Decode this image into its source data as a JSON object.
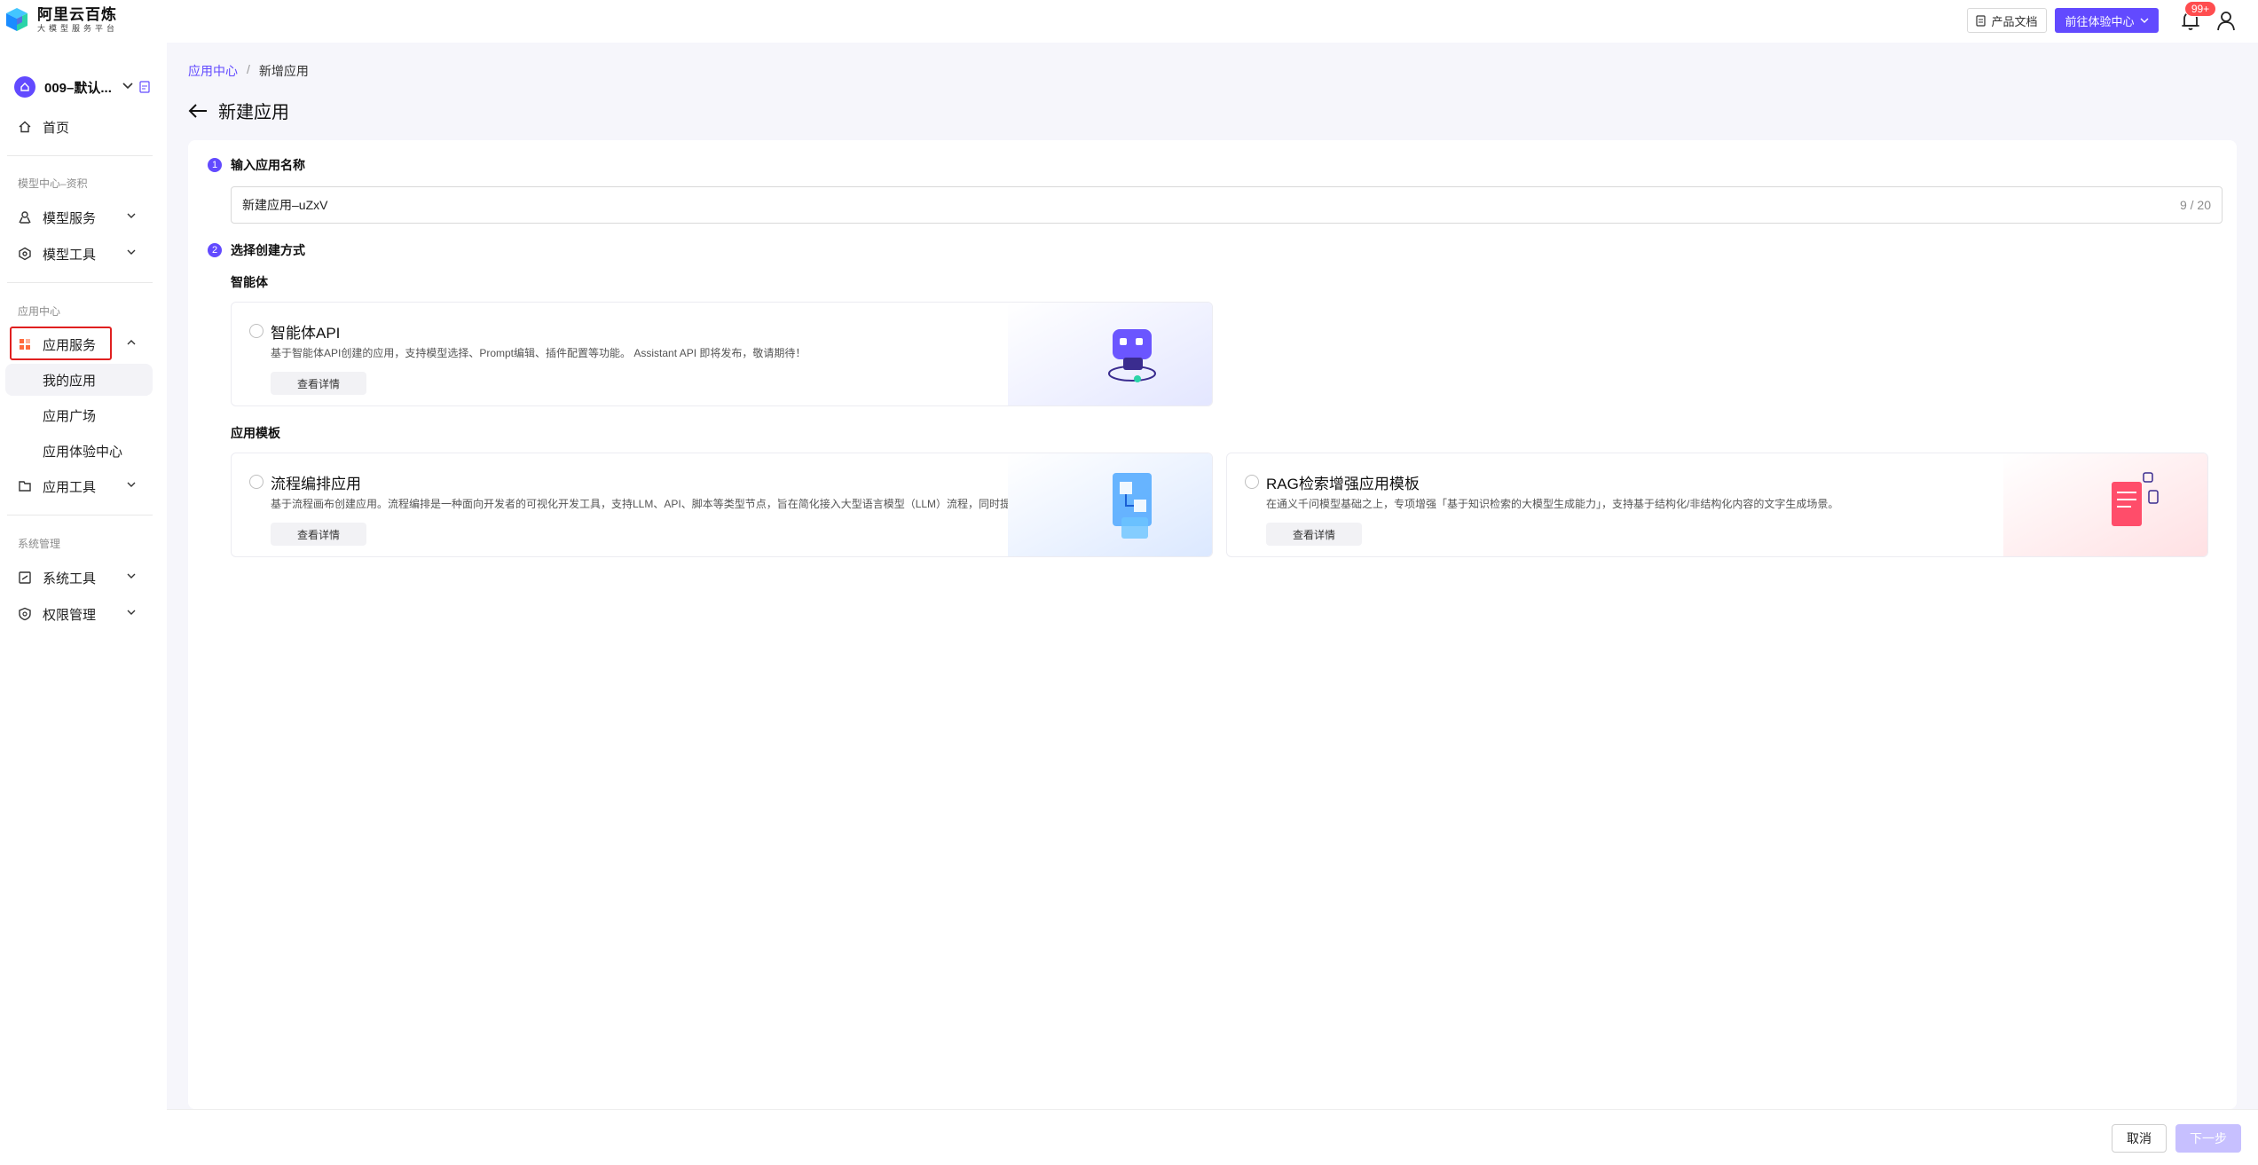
{
  "brand": {
    "name": "阿里云百炼",
    "subtitle": "大模型服务平台",
    "colors": {
      "primary": "#624aff",
      "danger": "#ff4d4f"
    }
  },
  "header": {
    "docs_label": "产品文档",
    "experience_label": "前往体验中心",
    "notification_count": "99+"
  },
  "sidebar": {
    "workspace_name": "009–默认...",
    "home": "首页",
    "section_model": "模型中心–资积",
    "model_service": "模型服务",
    "model_tools": "模型工具",
    "section_app": "应用中心",
    "app_service": "应用服务",
    "my_apps": "我的应用",
    "app_plaza": "应用广场",
    "app_experience": "应用体验中心",
    "app_tools": "应用工具",
    "section_system": "系统管理",
    "system_tools": "系统工具",
    "permissions": "权限管理"
  },
  "breadcrumb": {
    "root": "应用中心",
    "sep": "/",
    "current": "新增应用"
  },
  "page": {
    "title": "新建应用"
  },
  "form": {
    "step1_num": "1",
    "step1_label": "输入应用名称",
    "name_value": "新建应用–uZxV",
    "name_counter": "9 / 20",
    "step2_num": "2",
    "step2_label": "选择创建方式",
    "group_agent": "智能体",
    "group_template": "应用模板",
    "options": [
      {
        "title": "智能体API",
        "desc": "基于智能体API创建的应用，支持模型选择、Prompt编辑、插件配置等功能。 Assistant API 即将发布，敬请期待！",
        "button": "查看详情"
      },
      {
        "title": "流程编排应用",
        "desc": "基于流程画布创建应用。流程编排是一种面向开发者的可视化开发工具，支持LLM、API、脚本等类型节点，旨在简化接入大型语言模型（LLM）流程，同时提供应用流程的全...",
        "button": "查看详情"
      },
      {
        "title": "RAG检索增强应用模板",
        "desc": "在通义千问模型基础之上，专项增强「基于知识检索的大模型生成能力」，支持基于结构化/非结构化内容的文字生成场景。",
        "button": "查看详情"
      }
    ]
  },
  "footer": {
    "cancel": "取消",
    "next": "下一步"
  }
}
